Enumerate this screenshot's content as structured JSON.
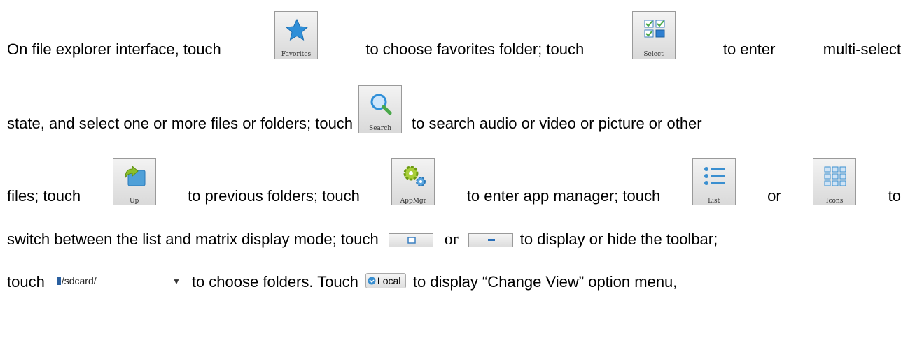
{
  "icons": {
    "favorites": {
      "label": "Favorites",
      "icon": "star-icon",
      "color": "#2f8fd8"
    },
    "select": {
      "label": "Select",
      "icon": "multi-select-icon",
      "color": "#4aa84a"
    },
    "search": {
      "label": "Search",
      "icon": "magnifier-icon",
      "color": "#2f8fd8"
    },
    "up": {
      "label": "Up",
      "icon": "folder-up-icon",
      "color": "#4fa0d8"
    },
    "appmgr": {
      "label": "AppMgr",
      "icon": "gears-icon",
      "color": "#8bbf2a"
    },
    "list": {
      "label": "List",
      "icon": "list-icon",
      "color": "#3a8fd0"
    },
    "icons_view": {
      "label": "Icons",
      "icon": "grid-icon",
      "color": "#3a8fd0"
    },
    "show_toolbar": {
      "icon": "window-icon"
    },
    "hide_toolbar": {
      "icon": "minus-icon"
    },
    "folder_select": {
      "value": "/sdcard/",
      "icon": "sdcard-icon"
    },
    "local": {
      "label": "Local",
      "icon": "local-icon"
    }
  },
  "text": {
    "l1_a": "On file explorer interface, touch",
    "l1_b": "to choose favorites folder; touch",
    "l1_c": "to enter",
    "l1_d": "multi-select",
    "l2_a": "state, and select one or more files or folders; touch",
    "l2_b": "to search audio or video or picture or other",
    "l3_a": "files; touch",
    "l3_b": "to previous folders; touch",
    "l3_c": "to enter app manager; touch",
    "l3_d": "or",
    "l3_e": "to",
    "l4_a": "switch between the list and matrix display mode; touch",
    "l4_b": "or",
    "l4_c": "to display or hide the toolbar;",
    "l5_a": "touch",
    "l5_b": "to choose folders. Touch",
    "l5_c": "to display “Change View” option menu,"
  }
}
